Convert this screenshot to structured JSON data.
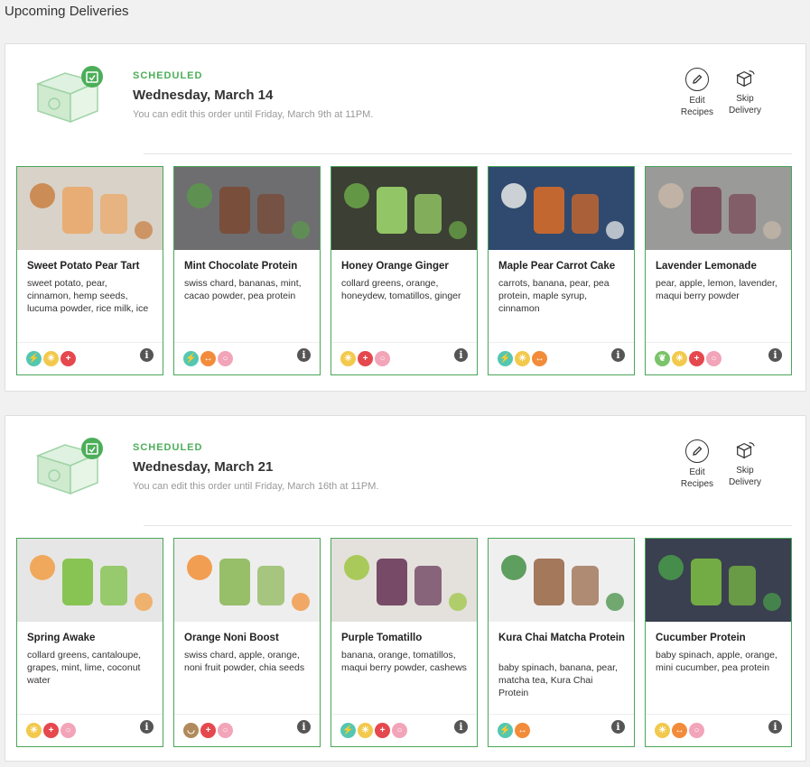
{
  "page": {
    "title": "Upcoming Deliveries"
  },
  "colors": {
    "accent_green": "#4cae59",
    "card_border": "#4aa65a"
  },
  "deliveries": [
    {
      "status": "SCHEDULED",
      "date": "Wednesday, March 14",
      "edit_note": "You can edit this order until Friday, March 9th at 11PM.",
      "actions": {
        "edit_line1": "Edit",
        "edit_line2": "Recipes",
        "skip_line1": "Skip",
        "skip_line2": "Delivery"
      },
      "recipes": [
        {
          "name": "Sweet Potato Pear Tart",
          "ingredients": "sweet potato, pear, cinnamon, hemp seeds, lucuma powder, rice milk, ice",
          "badges": [
            "energy-icon",
            "sun-icon",
            "plus-icon"
          ]
        },
        {
          "name": "Mint Chocolate Protein",
          "ingredients": "swiss chard, bananas, mint, cacao powder, pea protein",
          "badges": [
            "energy-icon",
            "fitness-icon",
            "ball-icon"
          ]
        },
        {
          "name": "Honey Orange Ginger",
          "ingredients": "collard greens, orange, honeydew, tomatillos, ginger",
          "badges": [
            "sun-icon",
            "plus-icon",
            "ball-icon"
          ]
        },
        {
          "name": "Maple Pear Carrot Cake",
          "ingredients": "carrots, banana, pear, pea protein, maple syrup, cinnamon",
          "badges": [
            "energy-icon",
            "sun-icon",
            "fitness-icon"
          ]
        },
        {
          "name": "Lavender Lemonade",
          "ingredients": "pear, apple, lemon, lavender, maqui berry powder",
          "badges": [
            "leaf-icon",
            "sun-icon",
            "plus-icon",
            "ball-icon"
          ]
        }
      ]
    },
    {
      "status": "SCHEDULED",
      "date": "Wednesday, March 21",
      "edit_note": "You can edit this order until Friday, March 16th at 11PM.",
      "actions": {
        "edit_line1": "Edit",
        "edit_line2": "Recipes",
        "skip_line1": "Skip",
        "skip_line2": "Delivery"
      },
      "recipes": [
        {
          "name": "Spring Awake",
          "ingredients": "collard greens, cantaloupe, grapes, mint, lime, coconut water",
          "badges": [
            "sun-icon",
            "plus-icon",
            "ball-icon"
          ]
        },
        {
          "name": "Orange Noni Boost",
          "ingredients": "swiss chard, apple, orange, noni fruit powder, chia seeds",
          "badges": [
            "bowl-icon",
            "plus-icon",
            "ball-icon"
          ]
        },
        {
          "name": "Purple Tomatillo",
          "ingredients": "banana, orange, tomatillos, maqui berry powder, cashews",
          "badges": [
            "energy-icon",
            "sun-icon",
            "plus-icon",
            "ball-icon"
          ]
        },
        {
          "name": "Kura Chai Matcha Protein",
          "ingredients": "baby spinach, banana, pear, matcha tea, Kura Chai Protein",
          "badges": [
            "energy-icon",
            "fitness-icon"
          ]
        },
        {
          "name": "Cucumber Protein",
          "ingredients": "baby spinach, apple, orange, mini cucumber, pea protein",
          "badges": [
            "sun-icon",
            "fitness-icon",
            "ball-icon"
          ]
        }
      ]
    }
  ]
}
